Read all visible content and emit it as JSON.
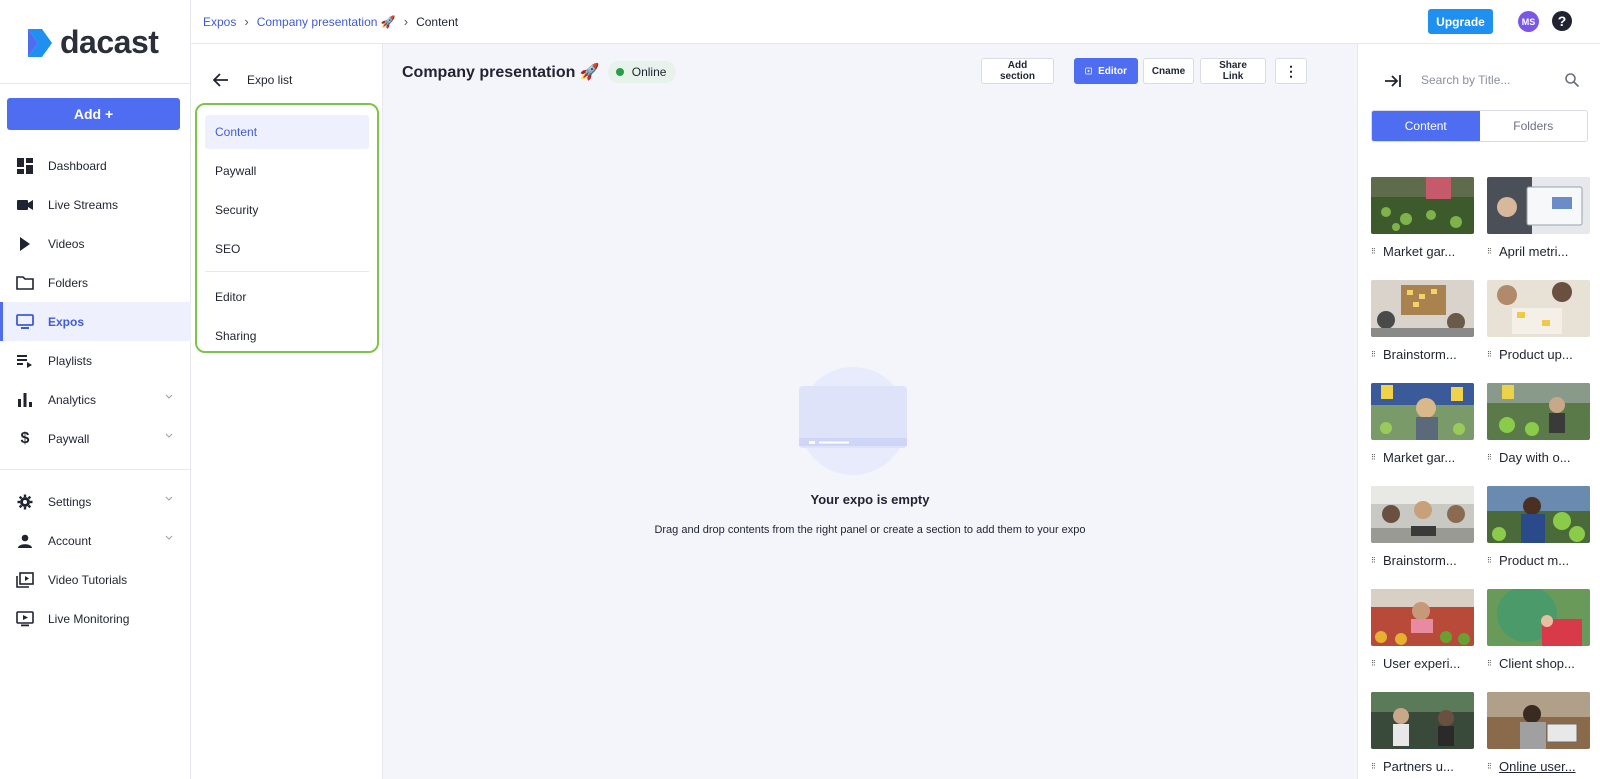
{
  "brand": {
    "name": "dacast",
    "accent": "#4e6df0"
  },
  "nav": {
    "add_label": "Add +",
    "items": [
      {
        "label": "Dashboard",
        "icon": "dashboard-icon"
      },
      {
        "label": "Live Streams",
        "icon": "camera-icon"
      },
      {
        "label": "Videos",
        "icon": "play-icon"
      },
      {
        "label": "Folders",
        "icon": "folder-icon"
      },
      {
        "label": "Expos",
        "icon": "monitor-icon",
        "active": true
      },
      {
        "label": "Playlists",
        "icon": "playlist-icon"
      },
      {
        "label": "Analytics",
        "icon": "bar-chart-icon"
      },
      {
        "label": "Paywall",
        "icon": "dollar-icon"
      },
      {
        "label": "Settings",
        "icon": "gear-icon"
      },
      {
        "label": "Account",
        "icon": "person-icon"
      },
      {
        "label": "Video Tutorials",
        "icon": "video-library-icon"
      },
      {
        "label": "Live Monitoring",
        "icon": "live-tv-icon"
      }
    ]
  },
  "breadcrumb": {
    "items": [
      "Expos",
      "Company presentation 🚀",
      "Content"
    ]
  },
  "topbar": {
    "upgrade_label": "Upgrade",
    "avatar_initials": "MS",
    "help_label": "?"
  },
  "settings_menu": {
    "back_label": "Expo list",
    "items": [
      "Content",
      "Paywall",
      "Security",
      "SEO",
      "Editor",
      "Sharing"
    ]
  },
  "main": {
    "title": "Company presentation 🚀",
    "status": "Online",
    "buttons": {
      "add_section": "Add section",
      "editor": "Editor",
      "cname": "Cname",
      "share_link": "Share Link",
      "more": "⋮"
    },
    "empty_title": "Your expo is empty",
    "empty_subtitle": "Drag and drop contents from the right panel or create a section to add them to your expo"
  },
  "right_panel": {
    "search_placeholder": "Search by Title...",
    "tabs": {
      "content": "Content",
      "folders": "Folders"
    },
    "items": [
      "Market gar...",
      "April metri...",
      "Brainstorm...",
      "Product up...",
      "Market gar...",
      "Day with o...",
      "Brainstorm...",
      "Product m...",
      "User experi...",
      "Client shop...",
      "Partners u...",
      "Online user..."
    ]
  }
}
